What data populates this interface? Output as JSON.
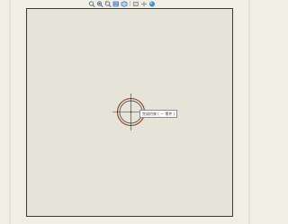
{
  "toolbar": {
    "buttons": [
      {
        "icon": "zoom-fit-icon",
        "color": "#5a6a8a"
      },
      {
        "icon": "zoom-area-icon",
        "color": "#5a6a8a"
      },
      {
        "icon": "zoom-previous-icon",
        "color": "#5a6a8a"
      },
      {
        "icon": "section-view-icon",
        "color": "#3a6fb0"
      },
      {
        "icon": "view-orientation-icon",
        "color": "#3a6fb0"
      },
      {
        "icon": "display-style-icon",
        "color": "#777777"
      },
      {
        "icon": "hide-show-icon",
        "color": "#777777"
      },
      {
        "icon": "appearance-icon",
        "color": "#3a6fb0"
      },
      {
        "icon": "scene-icon",
        "color": "#4a8fd0"
      }
    ]
  },
  "graphics_area": {
    "background": "#e6e4d8",
    "border": "#3a3a3a"
  },
  "sketch": {
    "circle_color": "#8b3a1a",
    "crosshair_color": "#333333"
  },
  "tooltip": {
    "text": "完成约束 ( 一 零件 )"
  }
}
